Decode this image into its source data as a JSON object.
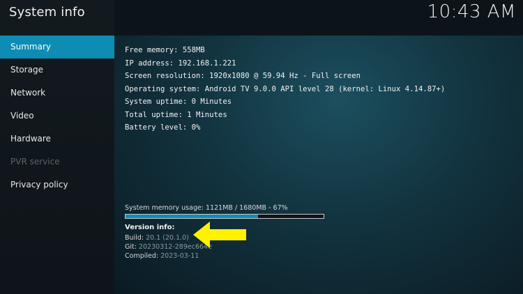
{
  "header": {
    "title": "System info",
    "clock": "10:43 AM"
  },
  "sidebar": {
    "items": [
      {
        "label": "Summary",
        "state": "active"
      },
      {
        "label": "Storage",
        "state": "normal"
      },
      {
        "label": "Network",
        "state": "normal"
      },
      {
        "label": "Video",
        "state": "normal"
      },
      {
        "label": "Hardware",
        "state": "normal"
      },
      {
        "label": "PVR service",
        "state": "disabled"
      },
      {
        "label": "Privacy policy",
        "state": "normal"
      }
    ]
  },
  "summary": {
    "lines": [
      "Free memory: 558MB",
      "IP address: 192.168.1.221",
      "Screen resolution: 1920x1080 @ 59.94 Hz - Full screen",
      "Operating system: Android TV 9.0.0 API level 28 (kernel: Linux 4.14.87+)",
      "System uptime: 0 Minutes",
      "Total uptime: 1 Minutes",
      "Battery level: 0%"
    ],
    "memory_usage_label": "System memory usage: 1121MB / 1680MB - 67%",
    "memory_usage_percent": 67,
    "version": {
      "title": "Version info:",
      "build_label": "Build:",
      "build_value": "20.1 (20.1.0)",
      "git_label": "Git:",
      "git_value": "20230312-289ec664e",
      "compiled_label": "Compiled:",
      "compiled_value": "2023-03-11"
    }
  },
  "annotation": {
    "icon": "arrow-left-icon",
    "color": "#fff200"
  },
  "colors": {
    "accent": "#0e8cb4"
  }
}
